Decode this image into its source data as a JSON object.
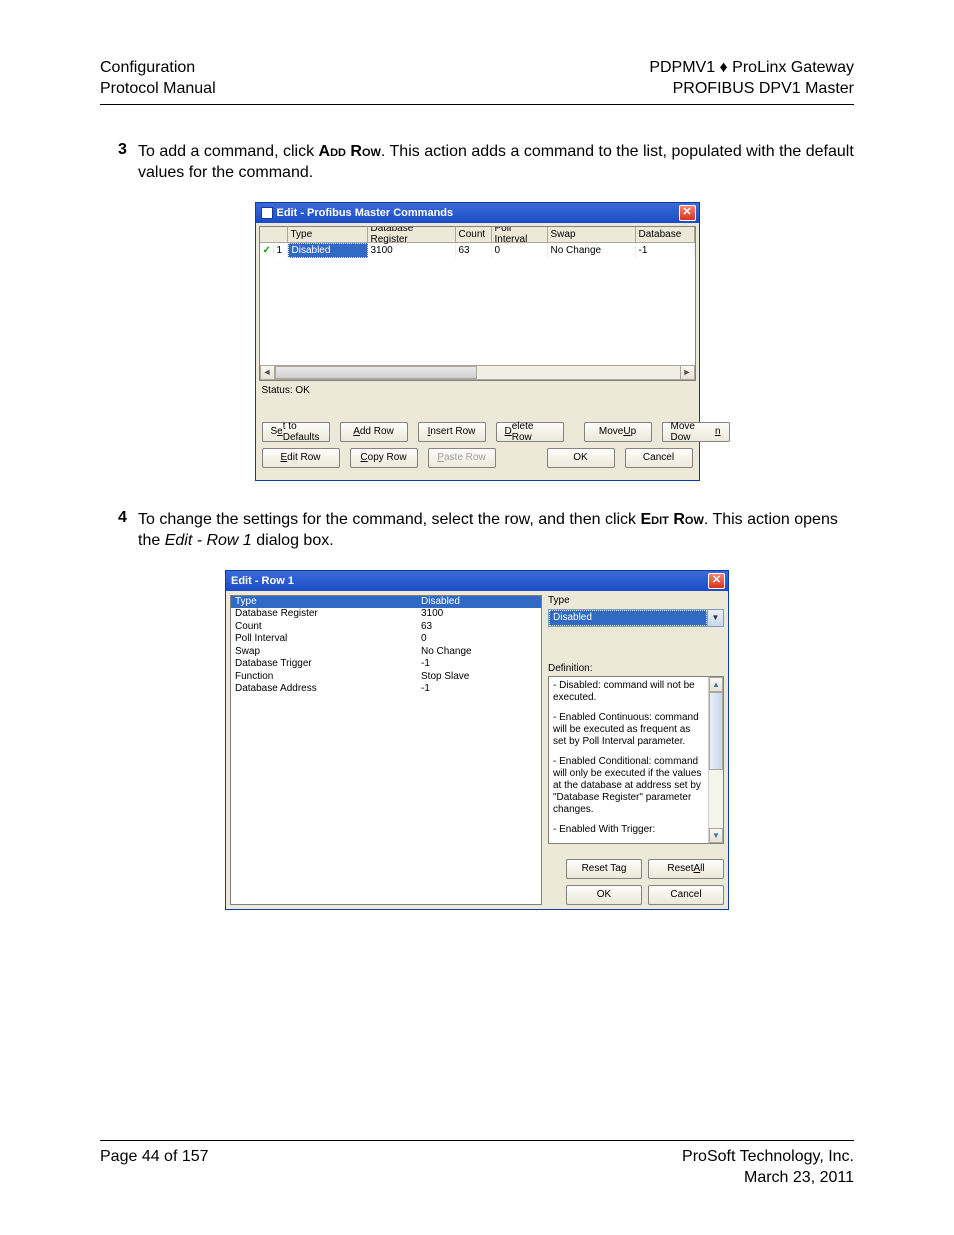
{
  "header": {
    "left_line1": "Configuration",
    "left_line2": "Protocol Manual",
    "right_line1": "PDPMV1 ♦ ProLinx Gateway",
    "right_line2": "PROFIBUS DPV1 Master"
  },
  "step3": {
    "num": "3",
    "text_before": "To add a command, click ",
    "bold": "Add Row",
    "text_after": ". This action adds a command to the list, populated with the default values for the command."
  },
  "dialog1": {
    "title": "Edit - Profibus Master Commands",
    "columns": {
      "c0": "",
      "c1": "Type",
      "c2": "Database Register",
      "c3": "Count",
      "c4": "Poll Interval",
      "c5": "Swap",
      "c6": "Database"
    },
    "row": {
      "check": "✓",
      "idx": "1",
      "type": "Disabled",
      "dbreg": "3100",
      "count": "63",
      "poll": "0",
      "swap": "No Change",
      "db": "-1"
    },
    "status": "Status: OK",
    "buttons": {
      "set_defaults_pre": "S",
      "set_defaults_u": "e",
      "set_defaults_post": "t to Defaults",
      "add_row_u": "A",
      "add_row_post": "dd Row",
      "insert_row_u": "I",
      "insert_row_post": "nsert Row",
      "delete_row_u": "D",
      "delete_row_post": "elete Row",
      "move_up_pre": "Move ",
      "move_up_u": "U",
      "move_up_post": "p",
      "move_down_pre": "Move Dow",
      "move_down_u": "n",
      "edit_row_u": "E",
      "edit_row_post": "dit Row",
      "copy_row_u": "C",
      "copy_row_post": "opy Row",
      "paste_row_u": "P",
      "paste_row_post": "aste Row",
      "ok": "OK",
      "cancel": "Cancel"
    }
  },
  "step4": {
    "num": "4",
    "text_before": "To change the settings for the command, select the row, and then click ",
    "bold": "Edit Row",
    "text_mid": ". This action opens the ",
    "italic": "Edit - Row 1",
    "text_after": " dialog box."
  },
  "dialog2": {
    "title": "Edit - Row 1",
    "params": [
      {
        "name": "Type",
        "value": "Disabled",
        "selected": true
      },
      {
        "name": "Database Register",
        "value": "3100"
      },
      {
        "name": "Count",
        "value": "63"
      },
      {
        "name": "Poll Interval",
        "value": "0"
      },
      {
        "name": "Swap",
        "value": "No Change"
      },
      {
        "name": "Database Trigger",
        "value": "-1"
      },
      {
        "name": "Function",
        "value": "Stop Slave"
      },
      {
        "name": "Database Address",
        "value": "-1"
      }
    ],
    "right": {
      "field_label": "Type",
      "combo_value": "Disabled",
      "def_label": "Definition:",
      "def_p1": "- Disabled: command will not be executed.",
      "def_p2": "- Enabled Continuous: command will be executed as frequent as set by Poll Interval parameter.",
      "def_p3": "- Enabled Conditional: command will only be executed if the values at the database at address set by \"Database Register\" parameter changes.",
      "def_p4": "- Enabled With Trigger:"
    },
    "buttons": {
      "reset_tag": "Reset Tag",
      "reset_all_pre": "Reset ",
      "reset_all_u": "A",
      "reset_all_post": "ll",
      "ok": "OK",
      "cancel": "Cancel"
    }
  },
  "footer": {
    "left": "Page 44 of 157",
    "right_line1": "ProSoft Technology, Inc.",
    "right_line2": "March 23, 2011"
  }
}
